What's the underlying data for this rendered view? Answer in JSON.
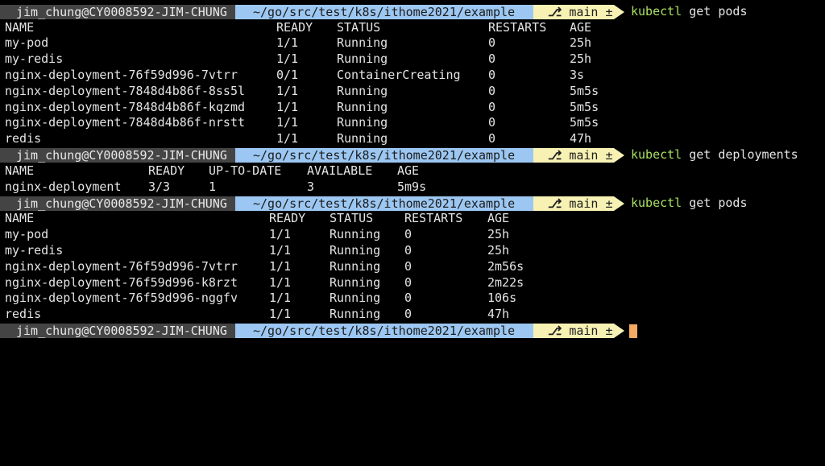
{
  "colors": {
    "background": "#000000",
    "text": "#e4e4e4",
    "prompt_user_bg": "#444444",
    "prompt_path_bg": "#9cc7f2",
    "prompt_git_bg": "#f7f2b4",
    "command_keyword": "#a8e063",
    "cursor": "#f5a962"
  },
  "prompt": {
    "user_host": "jim_chung@CY0008592-JIM-CHUNG",
    "path": "~/go/src/test/k8s/ithome2021/example",
    "branch_icon": "git-branch-icon",
    "branch": "main ±"
  },
  "blocks": [
    {
      "command": {
        "program": "kubectl",
        "args": "get pods"
      },
      "columns": [
        "NAME",
        "READY",
        "STATUS",
        "RESTARTS",
        "AGE"
      ],
      "rows": [
        [
          "my-pod",
          "1/1",
          "Running",
          "0",
          "25h"
        ],
        [
          "my-redis",
          "1/1",
          "Running",
          "0",
          "25h"
        ],
        [
          "nginx-deployment-76f59d996-7vtrr",
          "0/1",
          "ContainerCreating",
          "0",
          "3s"
        ],
        [
          "nginx-deployment-7848d4b86f-8ss5l",
          "1/1",
          "Running",
          "0",
          "5m5s"
        ],
        [
          "nginx-deployment-7848d4b86f-kqzmd",
          "1/1",
          "Running",
          "0",
          "5m5s"
        ],
        [
          "nginx-deployment-7848d4b86f-nrstt",
          "1/1",
          "Running",
          "0",
          "5m5s"
        ],
        [
          "redis",
          "1/1",
          "Running",
          "0",
          "47h"
        ]
      ]
    },
    {
      "command": {
        "program": "kubectl",
        "args": "get deployments"
      },
      "columns": [
        "NAME",
        "READY",
        "UP-TO-DATE",
        "AVAILABLE",
        "AGE"
      ],
      "rows": [
        [
          "nginx-deployment",
          "3/3",
          "1",
          "3",
          "5m9s"
        ]
      ]
    },
    {
      "command": {
        "program": "kubectl",
        "args": "get pods"
      },
      "columns": [
        "NAME",
        "READY",
        "STATUS",
        "RESTARTS",
        "AGE"
      ],
      "rows": [
        [
          "my-pod",
          "1/1",
          "Running",
          "0",
          "25h"
        ],
        [
          "my-redis",
          "1/1",
          "Running",
          "0",
          "25h"
        ],
        [
          "nginx-deployment-76f59d996-7vtrr",
          "1/1",
          "Running",
          "0",
          "2m56s"
        ],
        [
          "nginx-deployment-76f59d996-k8rzt",
          "1/1",
          "Running",
          "0",
          "2m22s"
        ],
        [
          "nginx-deployment-76f59d996-nggfv",
          "1/1",
          "Running",
          "0",
          "106s"
        ],
        [
          "redis",
          "1/1",
          "Running",
          "0",
          "47h"
        ]
      ]
    }
  ]
}
